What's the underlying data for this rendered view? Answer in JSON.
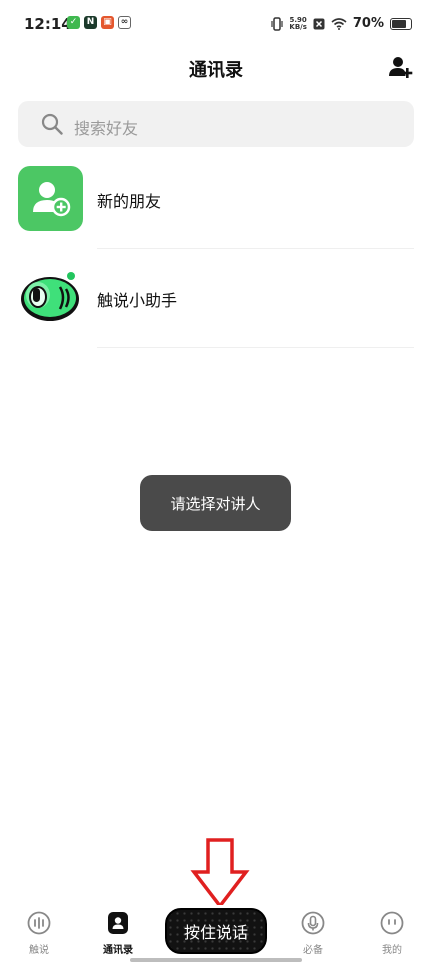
{
  "status_bar": {
    "time": "12:14",
    "net_speed_value": "5.90",
    "net_speed_unit": "KB/s",
    "battery": "70%",
    "battery_level": 0.7,
    "notif_icons": [
      "wechat-icon",
      "n-app-icon",
      "store-app-icon",
      "link-app-icon"
    ]
  },
  "header": {
    "title": "通讯录",
    "add_friend_icon": "add-user-icon"
  },
  "search": {
    "placeholder": "搜索好友"
  },
  "contacts": [
    {
      "name": "新的朋友",
      "icon": "new-friend-icon",
      "color": "#4cc764"
    },
    {
      "name": "触说小助手",
      "icon": "assistant-avatar-icon",
      "color": "#3fe07a"
    }
  ],
  "toast": {
    "text": "请选择对讲人"
  },
  "tab_bar": {
    "tabs": [
      {
        "label": "触说",
        "icon": "voice-wave-icon"
      },
      {
        "label": "通讯录",
        "icon": "contacts-icon",
        "active": true
      },
      {
        "label": "必备",
        "icon": "microphone-icon"
      },
      {
        "label": "我的",
        "icon": "profile-icon"
      }
    ],
    "push_to_talk": "按住说话"
  },
  "colors": {
    "accent_green": "#4cc764",
    "annotation_red": "#e02020",
    "toast_bg": "#4a4a4a"
  }
}
